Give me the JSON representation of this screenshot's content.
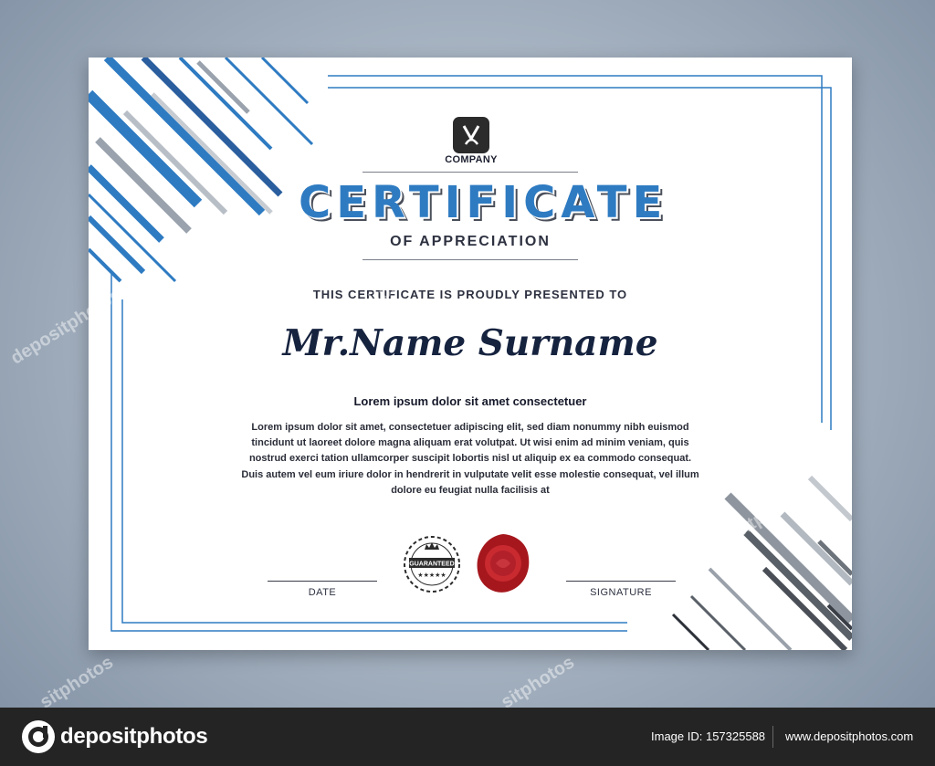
{
  "certificate": {
    "company": "COMPANY",
    "title": "CERTIFICATE",
    "subtitle": "OF APPRECIATION",
    "presented_line": "THIS CERTIFICATE IS PROUDLY PRESENTED TO",
    "recipient": "Mr.Name Surname",
    "lead": "Lorem ipsum dolor sit amet consectetuer",
    "body": "Lorem ipsum dolor sit amet, consectetuer adipiscing elit, sed diam nonummy nibh euismod tincidunt ut laoreet dolore magna aliquam erat volutpat. Ut wisi enim ad minim veniam, quis nostrud exerci tation ullamcorper suscipit lobortis nisl ut aliquip ex ea commodo consequat. Duis autem vel eum iriure dolor in hendrerit in vulputate velit esse molestie consequat, vel illum dolore eu feugiat nulla facilisis at",
    "date_label": "DATE",
    "signature_label": "SIGNATURE",
    "badge_text": "GUARANTEED",
    "badge_stars": "★★★★★",
    "accent_color": "#2e7bc2",
    "seal_color": "#b01e24"
  },
  "watermark": {
    "text": "depositphotos",
    "short_text": "sitphotos"
  },
  "footer": {
    "brand": "depositphotos",
    "image_id": "Image ID: 157325588",
    "site": "www.depositphotos.com"
  }
}
